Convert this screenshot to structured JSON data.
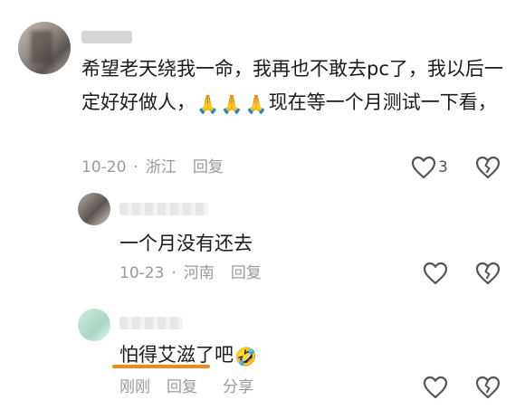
{
  "comments": [
    {
      "text_part1": "希望老天绕我一命，我再也不敢去pc了，我以后一定好好做人，",
      "emoji": [
        "🙏",
        "🙏",
        "🙏"
      ],
      "text_part2": "现在等一个月测试一下看，",
      "time": "10-20",
      "location": "浙江",
      "reply_label": "回复",
      "like_count": "3"
    },
    {
      "text": "一个月没有还去",
      "time": "10-23",
      "location": "河南",
      "reply_label": "回复"
    },
    {
      "text": "怕得艾滋了吧",
      "emoji": "🤣",
      "time": "刚刚",
      "reply_label": "回复",
      "share_label": "分享"
    }
  ],
  "meta_separator": "·",
  "colors": {
    "meta_text": "#9a9a9a",
    "underline": "#f08a1f",
    "icon_stroke": "#555555"
  },
  "icons": [
    "heart-outline-icon",
    "broken-heart-icon"
  ]
}
